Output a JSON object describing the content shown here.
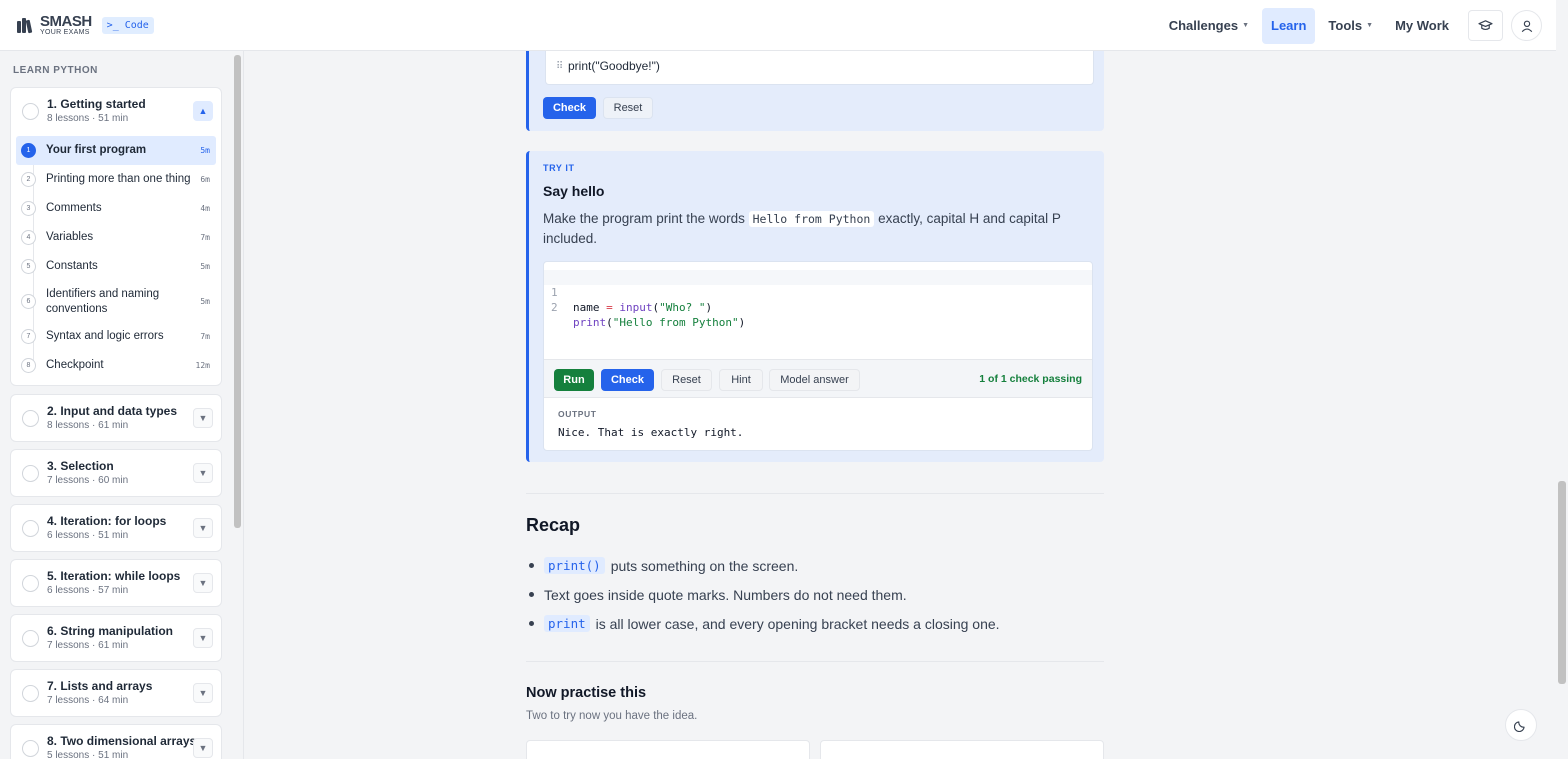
{
  "header": {
    "logo_line1": "SMASH",
    "logo_line2": "YOUR EXAMS",
    "code_badge": ">_ Code",
    "nav": [
      {
        "label": "Challenges",
        "has_caret": true
      },
      {
        "label": "Learn",
        "active": true
      },
      {
        "label": "Tools",
        "has_caret": true
      },
      {
        "label": "My Work"
      }
    ],
    "icons": [
      "graduation-cap-icon",
      "user-icon"
    ]
  },
  "sidebar": {
    "heading": "LEARN PYTHON",
    "chapters": [
      {
        "title": "1. Getting started",
        "meta": "8 lessons · 51 min",
        "expanded": true,
        "lessons": [
          {
            "num": "1",
            "title": "Your first program",
            "dur": "5m",
            "active": true
          },
          {
            "num": "2",
            "title": "Printing more than one thing",
            "dur": "6m"
          },
          {
            "num": "3",
            "title": "Comments",
            "dur": "4m"
          },
          {
            "num": "4",
            "title": "Variables",
            "dur": "7m"
          },
          {
            "num": "5",
            "title": "Constants",
            "dur": "5m"
          },
          {
            "num": "6",
            "title": "Identifiers and naming conventions",
            "dur": "5m"
          },
          {
            "num": "7",
            "title": "Syntax and logic errors",
            "dur": "7m"
          },
          {
            "num": "8",
            "title": "Checkpoint",
            "dur": "12m"
          }
        ]
      },
      {
        "title": "2. Input and data types",
        "meta": "8 lessons · 61 min"
      },
      {
        "title": "3. Selection",
        "meta": "7 lessons · 60 min"
      },
      {
        "title": "4. Iteration: for loops",
        "meta": "6 lessons · 51 min"
      },
      {
        "title": "5. Iteration: while loops",
        "meta": "6 lessons · 57 min"
      },
      {
        "title": "6. String manipulation",
        "meta": "7 lessons · 61 min"
      },
      {
        "title": "7. Lists and arrays",
        "meta": "7 lessons · 64 min"
      },
      {
        "title": "8. Two dimensional arrays",
        "meta": "5 lessons · 51 min"
      }
    ]
  },
  "exercise_prev": {
    "line_text": "print(\"Goodbye!\")",
    "check_label": "Check",
    "reset_label": "Reset"
  },
  "try_it": {
    "label": "TRY IT",
    "title": "Say hello",
    "desc_before": "Make the program print the words",
    "desc_code": "Hello from Python",
    "desc_after": "exactly, capital H and capital P included.",
    "code_lines": [
      {
        "num": "1",
        "text": "name = input(\"Who? \")"
      },
      {
        "num": "2",
        "text": "print(\"Hello from Python\")"
      }
    ],
    "buttons": {
      "run": "Run",
      "check": "Check",
      "reset": "Reset",
      "hint": "Hint",
      "model": "Model answer"
    },
    "check_status": "1 of 1 check passing",
    "output_label": "OUTPUT",
    "output_text": "Nice. That is exactly right."
  },
  "recap": {
    "title": "Recap",
    "items": [
      {
        "code": "print()",
        "text": "puts something on the screen."
      },
      {
        "code": "",
        "text": "Text goes inside quote marks. Numbers do not need them."
      },
      {
        "code": "print",
        "text": "is all lower case, and every opening bracket needs a closing one."
      }
    ]
  },
  "practice": {
    "title": "Now practise this",
    "subtitle": "Two to try now you have the idea."
  },
  "theme_toggle_icon": "moon-icon"
}
